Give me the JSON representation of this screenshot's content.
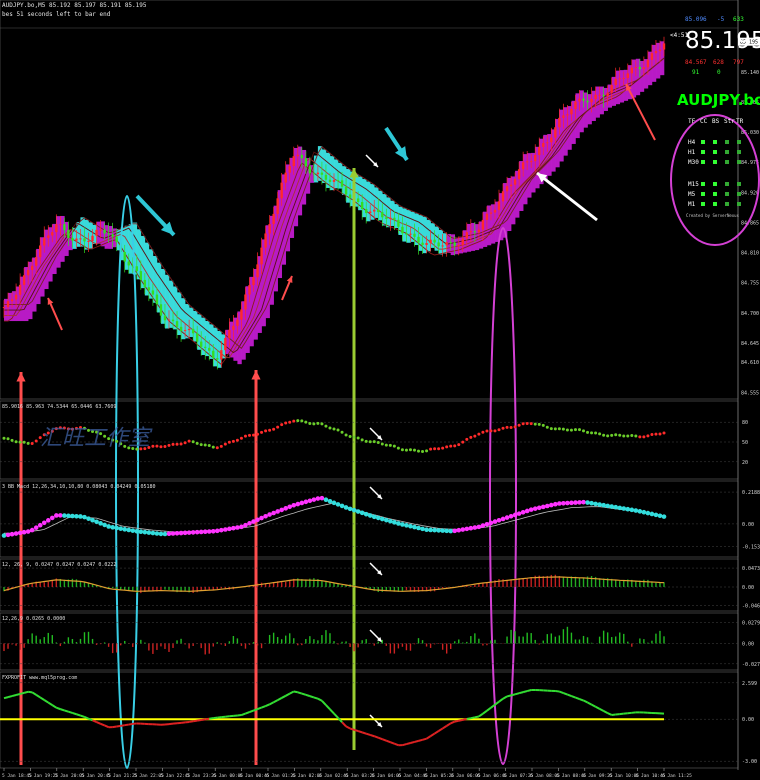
{
  "header": {
    "title": "AUDJPY.bo,M5  85.192 85.197 85.191 85.195",
    "subtitle": "bes 51 seconds left to bar end"
  },
  "price_panel": {
    "price_axis": [
      "85.195",
      "85.140",
      "85.085",
      "85.030",
      "84.975",
      "84.920",
      "84.865",
      "84.810",
      "84.755",
      "84.700",
      "84.645",
      "84.610",
      "84.555"
    ],
    "current_price": "85.195",
    "price_badge": "85.195",
    "arrow_tag": "<4:51",
    "top_stats": {
      "a": "85.096",
      "b": "-5",
      "c": "633"
    },
    "second_stats": {
      "a": "84.567",
      "b": "628",
      "c": "797"
    },
    "third_stats": {
      "a": "91",
      "b": "0"
    }
  },
  "dashboard": {
    "symbol": "AUDJPY.bo",
    "columns": [
      "TF",
      "CC",
      "BS",
      "Str",
      "TR"
    ],
    "rows": [
      "H4",
      "H1",
      "M30",
      "M15",
      "M5",
      "M1"
    ],
    "footer": "Created by ServerNexus"
  },
  "panels": [
    {
      "header": "85.9016 85.963 74.5344 65.0446 63.7609",
      "axis": [
        "80",
        "50",
        "20"
      ]
    },
    {
      "header": "3 BB Macd 12,26,34,10,10,80 0.08043 0.04249 0.05180",
      "axis": [
        "0.2188",
        "0.00",
        "-0.1537"
      ]
    },
    {
      "header": "12, 26, 9, 0.0247 0.0247 0.0247 0.0222",
      "axis": [
        "0.0473",
        "0.00",
        "-0.0468"
      ]
    },
    {
      "header": "12,26,9 0.0265 0.0000",
      "axis": [
        "0.0279",
        "0.00",
        "-0.0271"
      ]
    },
    {
      "header": "FXPROFIT www.mql5prog.com",
      "axis": [
        "2.599",
        "0.00",
        "-3.00"
      ]
    }
  ],
  "watermark": "汇旺工作室",
  "time_labels": [
    "5 Jan 18:45",
    "5 Jan 19:25",
    "5 Jan 20:05",
    "5 Jan 20:45",
    "5 Jan 21:25",
    "5 Jan 22:05",
    "5 Jan 22:45",
    "5 Jan 23:25",
    "6 Jan 00:05",
    "6 Jan 00:45",
    "6 Jan 01:25",
    "6 Jan 02:05",
    "6 Jan 02:45",
    "6 Jan 03:25",
    "6 Jan 04:05",
    "6 Jan 04:45",
    "6 Jan 05:25",
    "6 Jan 06:05",
    "6 Jan 06:45",
    "6 Jan 07:25",
    "6 Jan 08:05",
    "6 Jan 08:45",
    "6 Jan 09:25",
    "6 Jan 10:05",
    "6 Jan 10:45",
    "6 Jan 11:25"
  ],
  "chart_data": {
    "type": "line",
    "x": [
      "5 Jan 18:45",
      "5 Jan 19:25",
      "5 Jan 20:05",
      "5 Jan 20:45",
      "5 Jan 21:25",
      "5 Jan 22:05",
      "5 Jan 22:45",
      "5 Jan 23:25",
      "6 Jan 00:05",
      "6 Jan 00:45",
      "6 Jan 01:25",
      "6 Jan 02:05",
      "6 Jan 02:45",
      "6 Jan 03:25",
      "6 Jan 04:05",
      "6 Jan 04:45",
      "6 Jan 05:25",
      "6 Jan 06:05",
      "6 Jan 06:45",
      "6 Jan 07:25",
      "6 Jan 08:05",
      "6 Jan 08:45",
      "6 Jan 09:25",
      "6 Jan 10:05",
      "6 Jan 10:45",
      "6 Jan 11:25"
    ],
    "series": [
      {
        "values": [
          84.7,
          84.79,
          84.86,
          84.83,
          84.85,
          84.77,
          84.7,
          84.66,
          84.62,
          84.7,
          84.86,
          84.99,
          84.95,
          84.92,
          84.88,
          84.86,
          84.82,
          84.83,
          84.85,
          84.93,
          84.98,
          85.05,
          85.09,
          85.11,
          85.15,
          85.19
        ]
      },
      {
        "values": [
          54,
          48,
          70,
          72,
          55,
          38,
          44,
          50,
          42,
          55,
          68,
          82,
          78,
          60,
          50,
          40,
          36,
          44,
          62,
          72,
          78,
          70,
          66,
          60,
          58,
          64
        ]
      },
      {
        "values": [
          -0.08,
          -0.05,
          0.06,
          0.05,
          -0.02,
          -0.05,
          -0.07,
          -0.06,
          -0.05,
          -0.02,
          0.06,
          0.13,
          0.18,
          0.11,
          0.05,
          0.0,
          -0.04,
          -0.05,
          -0.02,
          0.04,
          0.1,
          0.14,
          0.15,
          0.12,
          0.09,
          0.05
        ]
      },
      {
        "values": [
          -0.01,
          0.01,
          0.02,
          0.015,
          -0.005,
          -0.012,
          -0.01,
          -0.012,
          -0.008,
          0.0,
          0.01,
          0.02,
          0.018,
          0.005,
          -0.008,
          -0.012,
          -0.01,
          -0.002,
          0.01,
          0.018,
          0.026,
          0.028,
          0.025,
          0.02,
          0.016,
          0.012
        ]
      },
      {
        "values": [
          1.5,
          2.0,
          0.8,
          0.2,
          -0.6,
          -0.3,
          -0.4,
          -0.2,
          0.1,
          0.3,
          1.0,
          2.0,
          1.4,
          -0.6,
          -1.2,
          -1.9,
          -1.4,
          -0.2,
          0.2,
          1.6,
          2.1,
          2.0,
          1.3,
          0.3,
          0.5,
          0.4
        ]
      }
    ]
  }
}
